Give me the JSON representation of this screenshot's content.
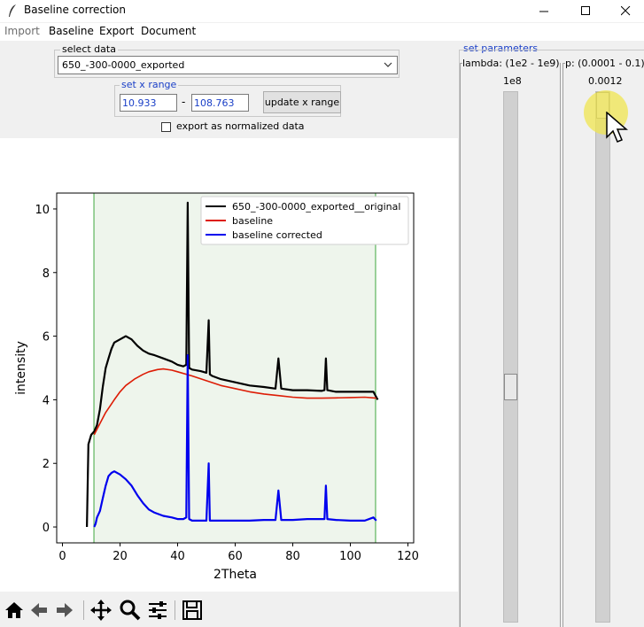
{
  "window": {
    "title": "Baseline correction",
    "minimize": "—",
    "maximize": "☐",
    "close": "✕"
  },
  "menu": {
    "import": "Import",
    "baseline": "Baseline",
    "export": "Export",
    "document": "Document"
  },
  "select_data": {
    "label": "select data",
    "value": "650_-300-0000_exported"
  },
  "x_range": {
    "label": "set x range",
    "min": "10.933",
    "dash": "-",
    "max": "108.763",
    "update_button": "update x range"
  },
  "export_normalized": {
    "label": "export as normalized data",
    "checked": false
  },
  "params": {
    "title": "set parameters",
    "lambda": {
      "label": "lambda: (1e2 - 1e9)",
      "value": "1e8",
      "fraction": 0.56
    },
    "p": {
      "label": "p: (0.0001 - 0.1)",
      "value": "0.0012",
      "fraction": 0.0
    }
  },
  "toolbar": {
    "home": "home-icon",
    "back": "back-icon",
    "forward": "forward-icon",
    "pan": "pan-icon",
    "zoom": "zoom-icon",
    "configure": "configure-icon",
    "save": "save-icon"
  },
  "colors": {
    "original": "#000000",
    "baseline": "#dd1c05",
    "corrected": "#0000ee",
    "range_fill": "#eef5ec",
    "range_line": "#3fa83f",
    "accent": "#1a3fc7"
  },
  "chart_data": {
    "type": "line",
    "xlabel": "2Theta",
    "ylabel": "intensity",
    "xlim": [
      -2,
      122
    ],
    "ylim": [
      -0.5,
      10.5
    ],
    "xticks": [
      0,
      20,
      40,
      60,
      80,
      100,
      120
    ],
    "yticks": [
      0,
      2,
      4,
      6,
      8,
      10
    ],
    "selected_range": [
      10.933,
      108.763
    ],
    "legend_position": "top-right",
    "series": [
      {
        "name": "650_-300-0000_exported__original",
        "x": [
          8.5,
          9,
          10,
          11,
          12,
          13,
          14,
          15,
          16,
          17,
          18,
          20,
          22,
          24,
          26,
          28,
          30,
          32,
          35,
          38,
          40,
          42,
          43,
          43.5,
          44,
          45,
          48,
          50,
          50.8,
          51.2,
          52,
          55,
          60,
          65,
          70,
          74,
          75,
          76,
          80,
          85,
          90,
          91,
          91.5,
          92,
          95,
          100,
          105,
          108,
          109.5
        ],
        "y": [
          0.0,
          2.6,
          2.9,
          3.0,
          3.2,
          3.7,
          4.4,
          5.0,
          5.3,
          5.6,
          5.8,
          5.9,
          6.0,
          5.9,
          5.7,
          5.55,
          5.45,
          5.4,
          5.3,
          5.2,
          5.1,
          5.05,
          5.1,
          10.2,
          5.0,
          4.95,
          4.9,
          4.85,
          6.5,
          4.8,
          4.75,
          4.65,
          4.55,
          4.45,
          4.4,
          4.35,
          5.3,
          4.35,
          4.3,
          4.3,
          4.28,
          4.3,
          5.3,
          4.3,
          4.25,
          4.25,
          4.25,
          4.25,
          4.0
        ]
      },
      {
        "name": "baseline",
        "x": [
          11,
          13,
          15,
          18,
          20,
          22,
          25,
          28,
          30,
          33,
          35,
          38,
          40,
          45,
          50,
          55,
          60,
          65,
          70,
          75,
          80,
          85,
          90,
          95,
          100,
          105,
          109
        ],
        "y": [
          2.9,
          3.25,
          3.6,
          4.0,
          4.25,
          4.45,
          4.65,
          4.8,
          4.88,
          4.95,
          4.97,
          4.93,
          4.88,
          4.75,
          4.6,
          4.45,
          4.35,
          4.25,
          4.18,
          4.13,
          4.08,
          4.05,
          4.05,
          4.06,
          4.07,
          4.08,
          4.05
        ]
      },
      {
        "name": "baseline corrected",
        "x": [
          11,
          11.5,
          12,
          13,
          14,
          15,
          16,
          17,
          18,
          20,
          22,
          24,
          26,
          28,
          30,
          32,
          35,
          38,
          40,
          42,
          43,
          43.5,
          44,
          45,
          48,
          50,
          50.8,
          51.2,
          52,
          55,
          60,
          65,
          70,
          74,
          75,
          76,
          80,
          85,
          90,
          91,
          91.5,
          92,
          95,
          100,
          105,
          108,
          109
        ],
        "y": [
          0.0,
          0.1,
          0.3,
          0.5,
          0.9,
          1.3,
          1.6,
          1.7,
          1.75,
          1.65,
          1.5,
          1.3,
          1.0,
          0.75,
          0.55,
          0.45,
          0.35,
          0.3,
          0.25,
          0.25,
          0.3,
          5.4,
          0.25,
          0.2,
          0.2,
          0.2,
          2.0,
          0.2,
          0.2,
          0.2,
          0.2,
          0.2,
          0.22,
          0.22,
          1.15,
          0.22,
          0.22,
          0.25,
          0.25,
          0.25,
          1.3,
          0.25,
          0.22,
          0.2,
          0.2,
          0.3,
          0.2
        ]
      }
    ]
  }
}
